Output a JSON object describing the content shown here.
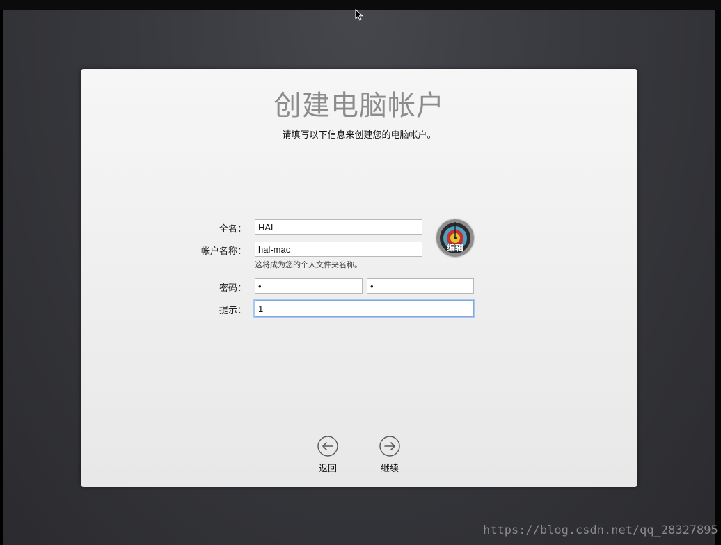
{
  "title": "创建电脑帐户",
  "subtitle": "请填写以下信息来创建您的电脑帐户。",
  "form": {
    "full_name_label": "全名：",
    "full_name_value": "HAL",
    "account_name_label": "帐户名称：",
    "account_name_value": "hal-mac",
    "account_name_hint": "这将成为您的个人文件夹名称。",
    "password_label": "密码：",
    "password_value": "•",
    "verify_value": "•",
    "hint_label": "提示：",
    "hint_value": "1"
  },
  "avatar": {
    "icon": "target-icon",
    "edit_label": "编辑"
  },
  "nav": {
    "back_label": "返回",
    "back_icon": "arrow-left-circle-icon",
    "continue_label": "继续",
    "continue_icon": "arrow-right-circle-icon"
  },
  "watermark": "https://blog.csdn.net/qq_28327895",
  "colors": {
    "focus_ring": "#a9c8ef",
    "title": "#8c8c8c"
  }
}
